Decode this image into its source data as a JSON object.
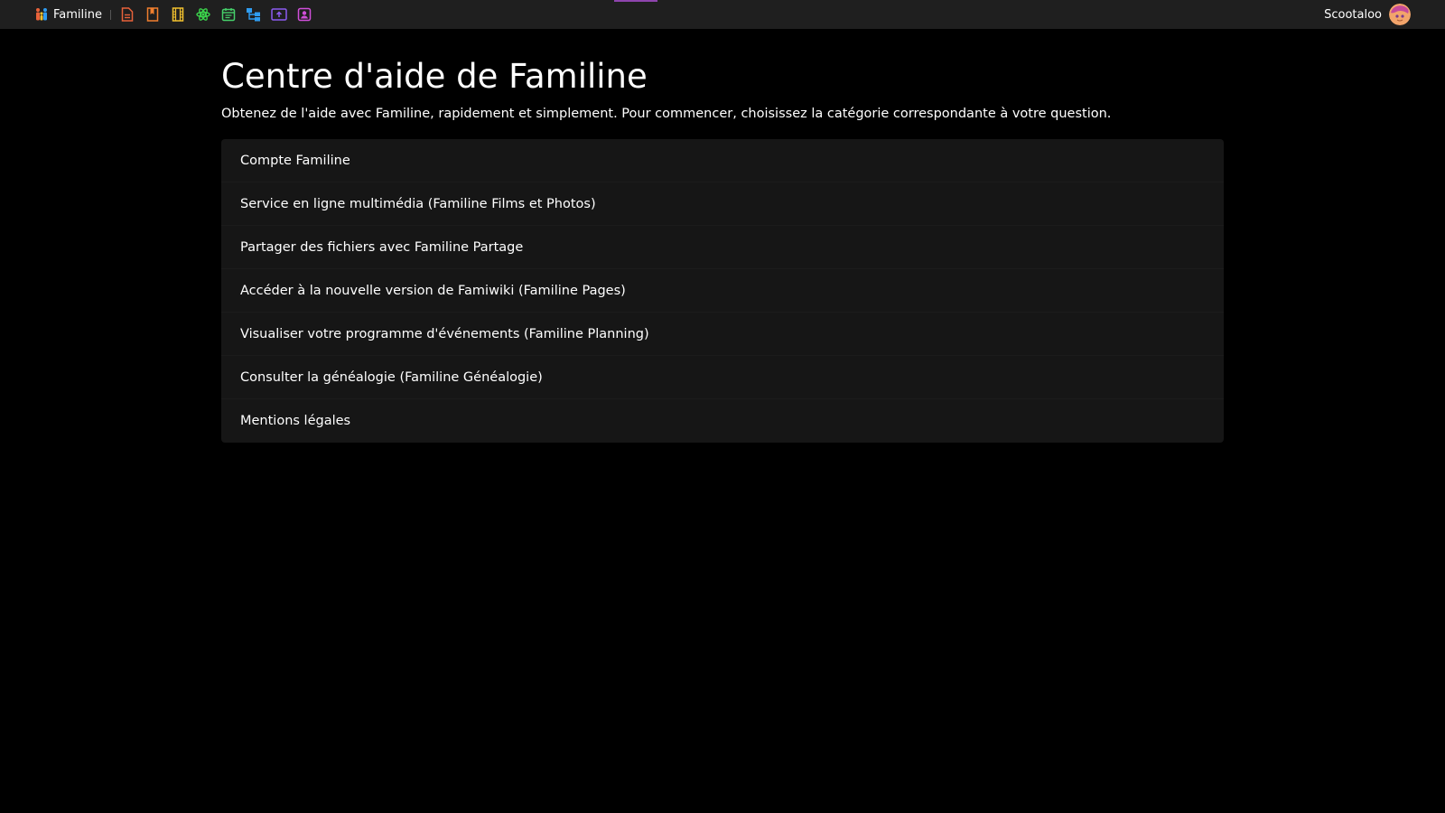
{
  "topbar": {
    "brand_label": "Familine",
    "accent_color": "#8e44ad",
    "apps": [
      {
        "name": "document-icon",
        "color": "#e8623a"
      },
      {
        "name": "bookmark-icon",
        "color": "#f07f2e"
      },
      {
        "name": "film-icon",
        "color": "#f2c12e"
      },
      {
        "name": "atom-icon",
        "color": "#3bd14b"
      },
      {
        "name": "calendar-icon",
        "color": "#46d06a"
      },
      {
        "name": "tree-icon",
        "color": "#2f9cf0"
      },
      {
        "name": "upload-box-icon",
        "color": "#8c5bf0"
      },
      {
        "name": "contact-card-icon",
        "color": "#d04fd9"
      }
    ],
    "user_name": "Scootaloo"
  },
  "main": {
    "title": "Centre d'aide de Familine",
    "subtitle": "Obtenez de l'aide avec Familine, rapidement et simplement. Pour commencer, choisissez la catégorie correspondante à votre question.",
    "categories": [
      "Compte Familine",
      "Service en ligne multimédia (Familine Films et Photos)",
      "Partager des fichiers avec Familine Partage",
      "Accéder à la nouvelle version de Famiwiki (Familine Pages)",
      "Visualiser votre programme d'événements (Familine Planning)",
      "Consulter la généalogie (Familine Généalogie)",
      "Mentions légales"
    ]
  }
}
